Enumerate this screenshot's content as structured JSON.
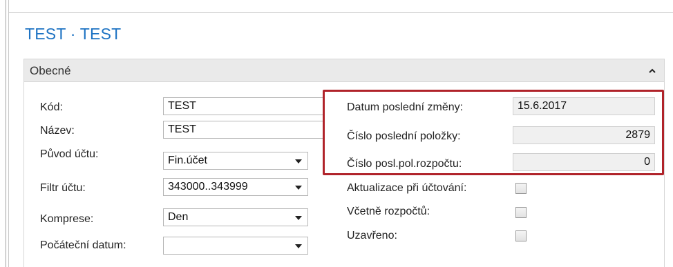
{
  "title": "TEST · TEST",
  "section": {
    "label": "Obecné"
  },
  "left": {
    "code_label": "Kód:",
    "code_value": "TEST",
    "name_label": "Název:",
    "name_value": "TEST",
    "origin_label": "Původ účtu:",
    "origin_value": "Fin.účet",
    "filter_label": "Filtr účtu:",
    "filter_value": "343000..343999",
    "compression_label": "Komprese:",
    "compression_value": "Den",
    "start_date_label": "Počáteční datum:",
    "start_date_value": ""
  },
  "right": {
    "last_modified_label": "Datum poslední změny:",
    "last_modified_value": "15.6.2017",
    "last_entry_label": "Číslo poslední položky:",
    "last_entry_value": "2879",
    "last_budget_entry_label": "Číslo posl.pol.rozpočtu:",
    "last_budget_entry_value": "0",
    "update_on_posting_label": "Aktualizace při účtování:",
    "include_budget_label": "Včetně rozpočtů:",
    "blocked_label": "Uzavřeno:"
  },
  "colors": {
    "title": "#1e73c3",
    "highlight": "#b0232a"
  }
}
